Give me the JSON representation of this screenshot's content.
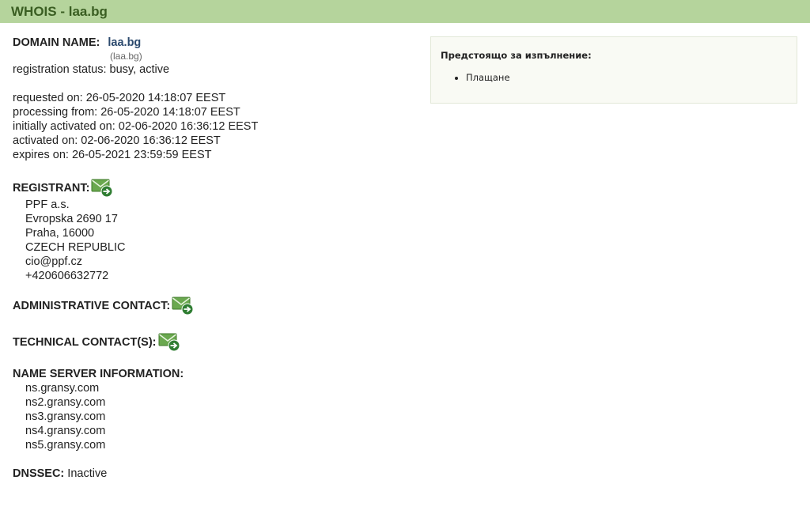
{
  "header": {
    "title": "WHOIS - laa.bg"
  },
  "domain": {
    "label": "DOMAIN NAME:",
    "name": "laa.bg",
    "idn": "(laa.bg)",
    "status_label": "registration status:",
    "status_value": "busy, active"
  },
  "dates": [
    "requested on: 26-05-2020 14:18:07 EEST",
    "processing from: 26-05-2020 14:18:07 EEST",
    "initially activated on: 02-06-2020 16:36:12 EEST",
    "activated on: 02-06-2020 16:36:12 EEST",
    "expires on: 26-05-2021 23:59:59 EEST"
  ],
  "registrant": {
    "label": "REGISTRANT:",
    "lines": [
      "PPF a.s.",
      "Evropska 2690 17",
      "Praha, 16000",
      "CZECH REPUBLIC",
      "cio@ppf.cz",
      "+420606632772"
    ]
  },
  "admin_contact": {
    "label": "ADMINISTRATIVE CONTACT:"
  },
  "tech_contact": {
    "label": "TECHNICAL CONTACT(S):"
  },
  "name_servers": {
    "label": "NAME SERVER INFORMATION:",
    "items": [
      "ns.gransy.com",
      "ns2.gransy.com",
      "ns3.gransy.com",
      "ns4.gransy.com",
      "ns5.gransy.com"
    ]
  },
  "dnssec": {
    "label": "DNSSEC:",
    "value": "Inactive"
  },
  "pending": {
    "title": "Предстоящо за изпълнение:",
    "items": [
      "Плащане"
    ]
  },
  "icons": {
    "contact": "mail-forward-icon"
  },
  "colors": {
    "header_bg": "#b5d49c",
    "header_text": "#3a5e22",
    "link": "#2c4a6e"
  }
}
